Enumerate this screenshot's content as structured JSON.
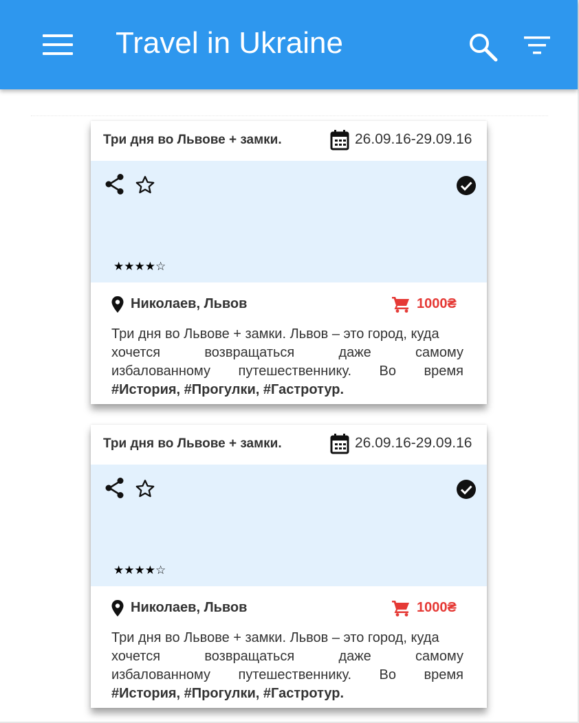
{
  "appbar": {
    "title": "Travel in Ukraine",
    "menu_icon": "hamburger-menu-icon",
    "search_icon": "search-icon",
    "filter_icon": "filter-icon",
    "color": "#2e97ee"
  },
  "cards": [
    {
      "title": "Три дня во Львове + замки.",
      "dates": "26.09.16-29.09.16",
      "rating": "★★★★☆",
      "rating_value": 4,
      "rating_max": 5,
      "location": "Николаев, Львов",
      "price": "1000₴",
      "description_lines": [
        "Три дня во Львове + замки. Львов – это город, куда",
        "хочется возвращаться даже самому",
        "избалованному путешественнику. Во время"
      ],
      "tags": "#История, #Прогулки, #Гастротур.",
      "completed": true
    },
    {
      "title": "Три дня во Львове + замки.",
      "dates": "26.09.16-29.09.16",
      "rating": "★★★★☆",
      "rating_value": 4,
      "rating_max": 5,
      "location": "Николаев, Львов",
      "price": "1000₴",
      "description_lines": [
        "Три дня во Львове + замки. Львов – это город, куда",
        "хочется возвращаться даже самому",
        "избалованному путешественнику. Во время"
      ],
      "tags": "#История, #Прогулки, #Гастротур.",
      "completed": true
    }
  ],
  "colors": {
    "accent": "#2e97ee",
    "media_bg": "#e3f1fd",
    "price": "#e53935",
    "text": "#333333"
  }
}
